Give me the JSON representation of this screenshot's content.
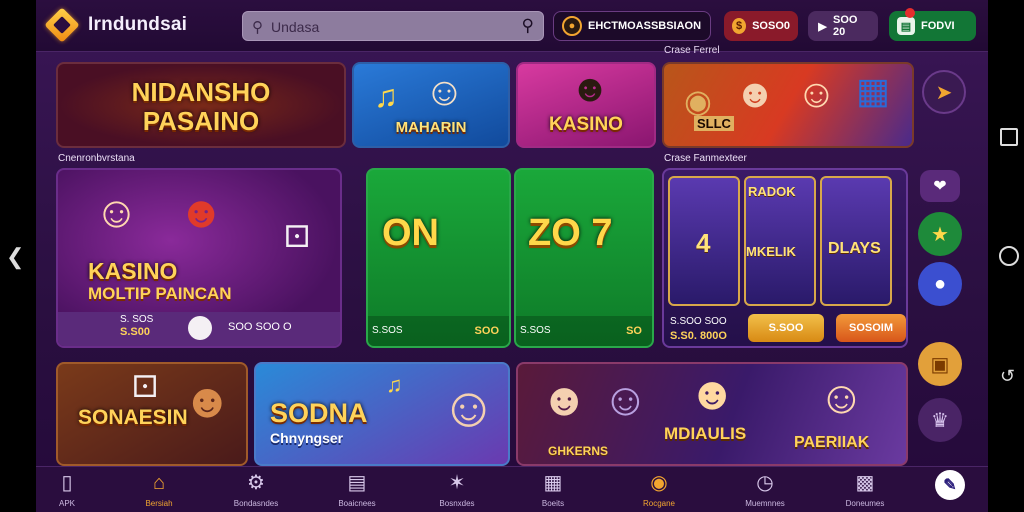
{
  "header": {
    "brand": "Irndundsai",
    "search_placeholder": "Undasa",
    "promo_label": "EHCTMOASSBSIAON",
    "balance_label": "SOSO0",
    "bonus_label": "SOO 20",
    "deposit_label": "FODVI"
  },
  "sections": {
    "row1_label": "Crase Ferrel",
    "row2_left_label": "Cnenronbvrstana",
    "row2_right_label": "Crase Fanmexteer"
  },
  "cards": {
    "hero": {
      "line1": "NIDANSHO",
      "line2": "PASAINO"
    },
    "maharin": {
      "title": "MAHARIN"
    },
    "kasino1": {
      "title": "KASINO"
    },
    "slots1": {
      "title": "SLLC"
    },
    "kasino2": {
      "title": "KASINO",
      "subtitle": "MOLTIP PAINCAN",
      "stat1": "S. SOS",
      "stat2": "S.S00",
      "stat3": "SOO SOO O"
    },
    "slot_a": {
      "big": "ON",
      "foot_left": "S.SOS",
      "foot_right": "SOO"
    },
    "slot_b": {
      "big": "ZO 7",
      "foot_left": "S.SOS",
      "foot_right": "SO"
    },
    "slots2": {
      "reel1": "4",
      "reel2": "MKELIK",
      "reel3": "DLAYS",
      "reel_top": "RADOK",
      "foot1": "S.SOO SOO",
      "foot2": "S.S0. 800O",
      "btn1": "S.SOO",
      "btn2": "SOSOIM"
    },
    "sonaesin": {
      "title": "SONAESIN"
    },
    "sodna": {
      "title": "SODNA",
      "subtitle": "Chnyngser"
    },
    "mdiaulis": {
      "t1": "GHKERNS",
      "t2": "MDIAULIS",
      "t3": "PAERIIAK"
    }
  },
  "bottom_nav": [
    {
      "icon": "home-icon",
      "label": "APK"
    },
    {
      "icon": "house-icon",
      "label": "Bersiah",
      "active": true
    },
    {
      "icon": "gear-icon",
      "label": "Bondasndes"
    },
    {
      "icon": "document-icon",
      "label": "Boaicnees"
    },
    {
      "icon": "star-icon",
      "label": "Bosnxdes"
    },
    {
      "icon": "chart-icon",
      "label": "Boeits"
    },
    {
      "icon": "coin-icon",
      "label": "Rocgane",
      "active": true
    },
    {
      "icon": "clock-icon",
      "label": "Muemnnes"
    },
    {
      "icon": "grid-icon",
      "label": "Doneumes"
    }
  ],
  "colors": {
    "accent": "#f2a530",
    "bg": "#2a0f40",
    "deposit": "#127636"
  }
}
